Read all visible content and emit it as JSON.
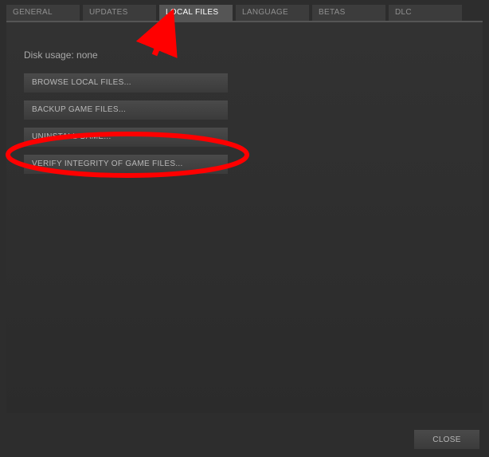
{
  "tabs": [
    {
      "label": "GENERAL",
      "active": false
    },
    {
      "label": "UPDATES",
      "active": false
    },
    {
      "label": "LOCAL FILES",
      "active": true
    },
    {
      "label": "LANGUAGE",
      "active": false
    },
    {
      "label": "BETAS",
      "active": false
    },
    {
      "label": "DLC",
      "active": false
    }
  ],
  "disk_usage_label": "Disk usage: none",
  "buttons": {
    "browse": "BROWSE LOCAL FILES...",
    "backup": "BACKUP GAME FILES...",
    "uninstall": "UNINSTALL GAME...",
    "verify": "VERIFY INTEGRITY OF GAME FILES..."
  },
  "close_label": "CLOSE",
  "annotation": {
    "arrow_color": "#ff0000",
    "circle_color": "#ff0000"
  }
}
